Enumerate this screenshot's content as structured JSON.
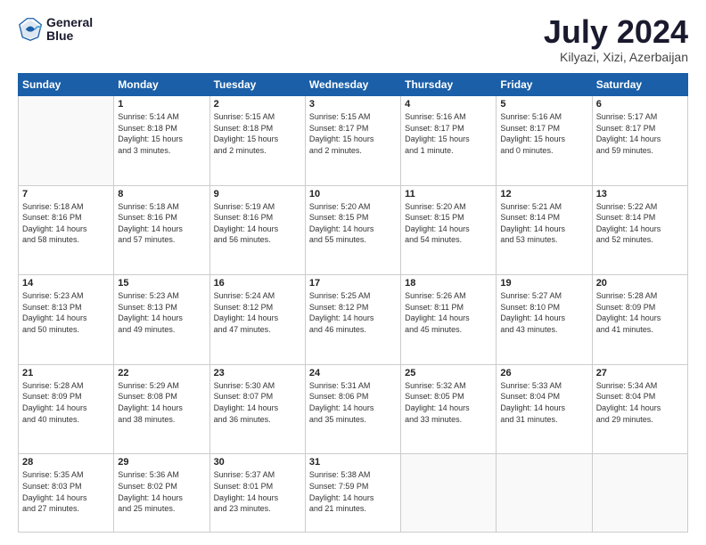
{
  "logo": {
    "line1": "General",
    "line2": "Blue"
  },
  "title": "July 2024",
  "subtitle": "Kilyazi, Xizi, Azerbaijan",
  "weekdays": [
    "Sunday",
    "Monday",
    "Tuesday",
    "Wednesday",
    "Thursday",
    "Friday",
    "Saturday"
  ],
  "weeks": [
    [
      {
        "day": "",
        "info": ""
      },
      {
        "day": "1",
        "info": "Sunrise: 5:14 AM\nSunset: 8:18 PM\nDaylight: 15 hours\nand 3 minutes."
      },
      {
        "day": "2",
        "info": "Sunrise: 5:15 AM\nSunset: 8:18 PM\nDaylight: 15 hours\nand 2 minutes."
      },
      {
        "day": "3",
        "info": "Sunrise: 5:15 AM\nSunset: 8:17 PM\nDaylight: 15 hours\nand 2 minutes."
      },
      {
        "day": "4",
        "info": "Sunrise: 5:16 AM\nSunset: 8:17 PM\nDaylight: 15 hours\nand 1 minute."
      },
      {
        "day": "5",
        "info": "Sunrise: 5:16 AM\nSunset: 8:17 PM\nDaylight: 15 hours\nand 0 minutes."
      },
      {
        "day": "6",
        "info": "Sunrise: 5:17 AM\nSunset: 8:17 PM\nDaylight: 14 hours\nand 59 minutes."
      }
    ],
    [
      {
        "day": "7",
        "info": "Sunrise: 5:18 AM\nSunset: 8:16 PM\nDaylight: 14 hours\nand 58 minutes."
      },
      {
        "day": "8",
        "info": "Sunrise: 5:18 AM\nSunset: 8:16 PM\nDaylight: 14 hours\nand 57 minutes."
      },
      {
        "day": "9",
        "info": "Sunrise: 5:19 AM\nSunset: 8:16 PM\nDaylight: 14 hours\nand 56 minutes."
      },
      {
        "day": "10",
        "info": "Sunrise: 5:20 AM\nSunset: 8:15 PM\nDaylight: 14 hours\nand 55 minutes."
      },
      {
        "day": "11",
        "info": "Sunrise: 5:20 AM\nSunset: 8:15 PM\nDaylight: 14 hours\nand 54 minutes."
      },
      {
        "day": "12",
        "info": "Sunrise: 5:21 AM\nSunset: 8:14 PM\nDaylight: 14 hours\nand 53 minutes."
      },
      {
        "day": "13",
        "info": "Sunrise: 5:22 AM\nSunset: 8:14 PM\nDaylight: 14 hours\nand 52 minutes."
      }
    ],
    [
      {
        "day": "14",
        "info": "Sunrise: 5:23 AM\nSunset: 8:13 PM\nDaylight: 14 hours\nand 50 minutes."
      },
      {
        "day": "15",
        "info": "Sunrise: 5:23 AM\nSunset: 8:13 PM\nDaylight: 14 hours\nand 49 minutes."
      },
      {
        "day": "16",
        "info": "Sunrise: 5:24 AM\nSunset: 8:12 PM\nDaylight: 14 hours\nand 47 minutes."
      },
      {
        "day": "17",
        "info": "Sunrise: 5:25 AM\nSunset: 8:12 PM\nDaylight: 14 hours\nand 46 minutes."
      },
      {
        "day": "18",
        "info": "Sunrise: 5:26 AM\nSunset: 8:11 PM\nDaylight: 14 hours\nand 45 minutes."
      },
      {
        "day": "19",
        "info": "Sunrise: 5:27 AM\nSunset: 8:10 PM\nDaylight: 14 hours\nand 43 minutes."
      },
      {
        "day": "20",
        "info": "Sunrise: 5:28 AM\nSunset: 8:09 PM\nDaylight: 14 hours\nand 41 minutes."
      }
    ],
    [
      {
        "day": "21",
        "info": "Sunrise: 5:28 AM\nSunset: 8:09 PM\nDaylight: 14 hours\nand 40 minutes."
      },
      {
        "day": "22",
        "info": "Sunrise: 5:29 AM\nSunset: 8:08 PM\nDaylight: 14 hours\nand 38 minutes."
      },
      {
        "day": "23",
        "info": "Sunrise: 5:30 AM\nSunset: 8:07 PM\nDaylight: 14 hours\nand 36 minutes."
      },
      {
        "day": "24",
        "info": "Sunrise: 5:31 AM\nSunset: 8:06 PM\nDaylight: 14 hours\nand 35 minutes."
      },
      {
        "day": "25",
        "info": "Sunrise: 5:32 AM\nSunset: 8:05 PM\nDaylight: 14 hours\nand 33 minutes."
      },
      {
        "day": "26",
        "info": "Sunrise: 5:33 AM\nSunset: 8:04 PM\nDaylight: 14 hours\nand 31 minutes."
      },
      {
        "day": "27",
        "info": "Sunrise: 5:34 AM\nSunset: 8:04 PM\nDaylight: 14 hours\nand 29 minutes."
      }
    ],
    [
      {
        "day": "28",
        "info": "Sunrise: 5:35 AM\nSunset: 8:03 PM\nDaylight: 14 hours\nand 27 minutes."
      },
      {
        "day": "29",
        "info": "Sunrise: 5:36 AM\nSunset: 8:02 PM\nDaylight: 14 hours\nand 25 minutes."
      },
      {
        "day": "30",
        "info": "Sunrise: 5:37 AM\nSunset: 8:01 PM\nDaylight: 14 hours\nand 23 minutes."
      },
      {
        "day": "31",
        "info": "Sunrise: 5:38 AM\nSunset: 7:59 PM\nDaylight: 14 hours\nand 21 minutes."
      },
      {
        "day": "",
        "info": ""
      },
      {
        "day": "",
        "info": ""
      },
      {
        "day": "",
        "info": ""
      }
    ]
  ]
}
